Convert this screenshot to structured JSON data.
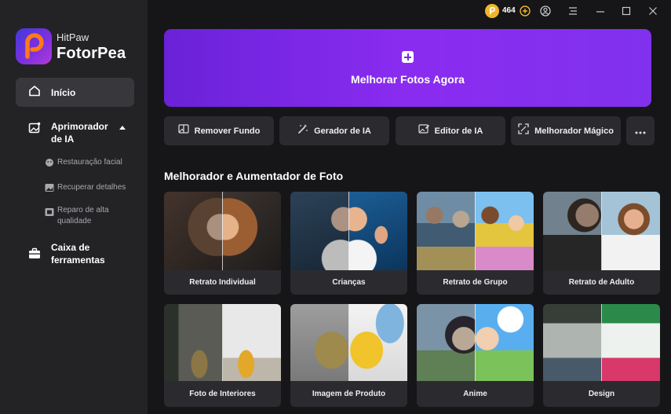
{
  "app": {
    "brand_sub": "HitPaw",
    "brand_main": "FotorPea"
  },
  "sidebar": {
    "home": "Início",
    "enhancer": "Aprimorador de IA",
    "sub": [
      "Restauração facial",
      "Recuperar detalhes",
      "Reparo de alta qualidade"
    ],
    "toolbox": "Caixa de ferramentas"
  },
  "titlebar": {
    "credits": "464"
  },
  "hero": {
    "label": "Melhorar Fotos Agora"
  },
  "tools": [
    "Remover Fundo",
    "Gerador de IA",
    "Editor de IA",
    "Melhorador Mágico"
  ],
  "section": {
    "title": "Melhorador e Aumentador de Foto"
  },
  "cards": [
    "Retrato Individual",
    "Crianças",
    "Retrato de Grupo",
    "Retrato de Adulto",
    "Foto de Interiores",
    "Imagem de Produto",
    "Anime",
    "Design"
  ],
  "colors": {
    "accent": "#8a2cf0",
    "sidebar": "#232326",
    "background": "#161618",
    "card": "#2b2b2f"
  }
}
